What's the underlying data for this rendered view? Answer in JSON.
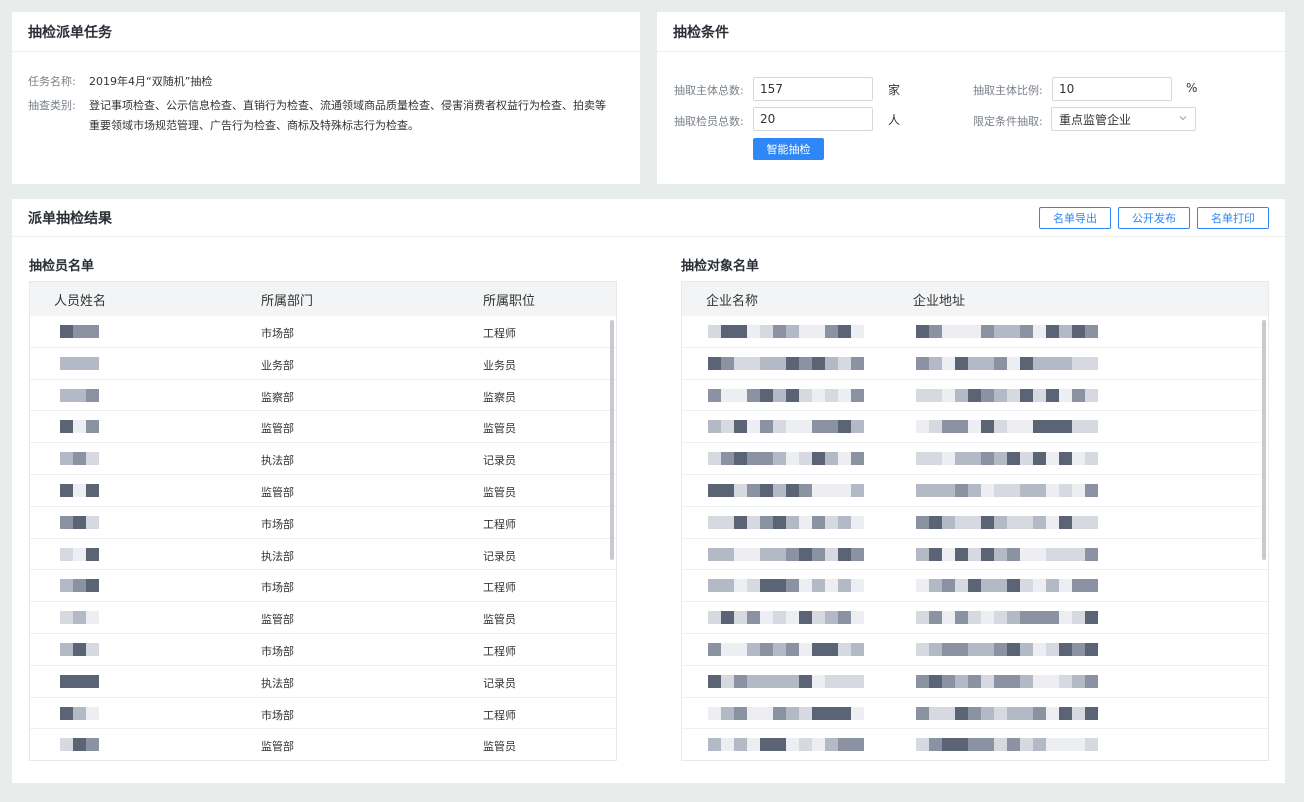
{
  "task": {
    "title": "抽检派单任务",
    "name_label": "任务名称:",
    "name_value": "2019年4月“双随机”抽检",
    "type_label": "抽查类别:",
    "type_value": "登记事项检查、公示信息检查、直销行为检查、流通领域商品质量检查、侵害消费者权益行为检查、拍卖等重要领域市场规范管理、广告行为检查、商标及特殊标志行为检查。"
  },
  "conditions": {
    "title": "抽检条件",
    "entity_total_label": "抽取主体总数:",
    "entity_total_value": "157",
    "entity_unit": "家",
    "entity_ratio_label": "抽取主体比例:",
    "entity_ratio_value": "10",
    "ratio_unit": "%",
    "inspector_total_label": "抽取检员总数:",
    "inspector_total_value": "20",
    "inspector_unit": "人",
    "limit_label": "限定条件抽取:",
    "limit_value": "重点监管企业",
    "smart_button": "智能抽检"
  },
  "results": {
    "title": "派单抽检结果",
    "export_button": "名单导出",
    "publish_button": "公开发布",
    "print_button": "名单打印",
    "inspectors": {
      "title": "抽检员名单",
      "columns": [
        "人员姓名",
        "所属部门",
        "所属职位"
      ],
      "rows": [
        [
          "市场部",
          "工程师"
        ],
        [
          "业务部",
          "业务员"
        ],
        [
          "监察部",
          "监察员"
        ],
        [
          "监管部",
          "监管员"
        ],
        [
          "执法部",
          "记录员"
        ],
        [
          "监管部",
          "监管员"
        ],
        [
          "市场部",
          "工程师"
        ],
        [
          "执法部",
          "记录员"
        ],
        [
          "市场部",
          "工程师"
        ],
        [
          "监管部",
          "监管员"
        ],
        [
          "市场部",
          "工程师"
        ],
        [
          "执法部",
          "记录员"
        ],
        [
          "市场部",
          "工程师"
        ],
        [
          "监管部",
          "监管员"
        ]
      ]
    },
    "targets": {
      "title": "抽检对象名单",
      "columns": [
        "企业名称",
        "企业地址"
      ],
      "row_count": 14
    }
  },
  "colors": {
    "accent": "#2f86f6",
    "background": "#e8eceb",
    "header_bg": "#f3f4f5"
  }
}
